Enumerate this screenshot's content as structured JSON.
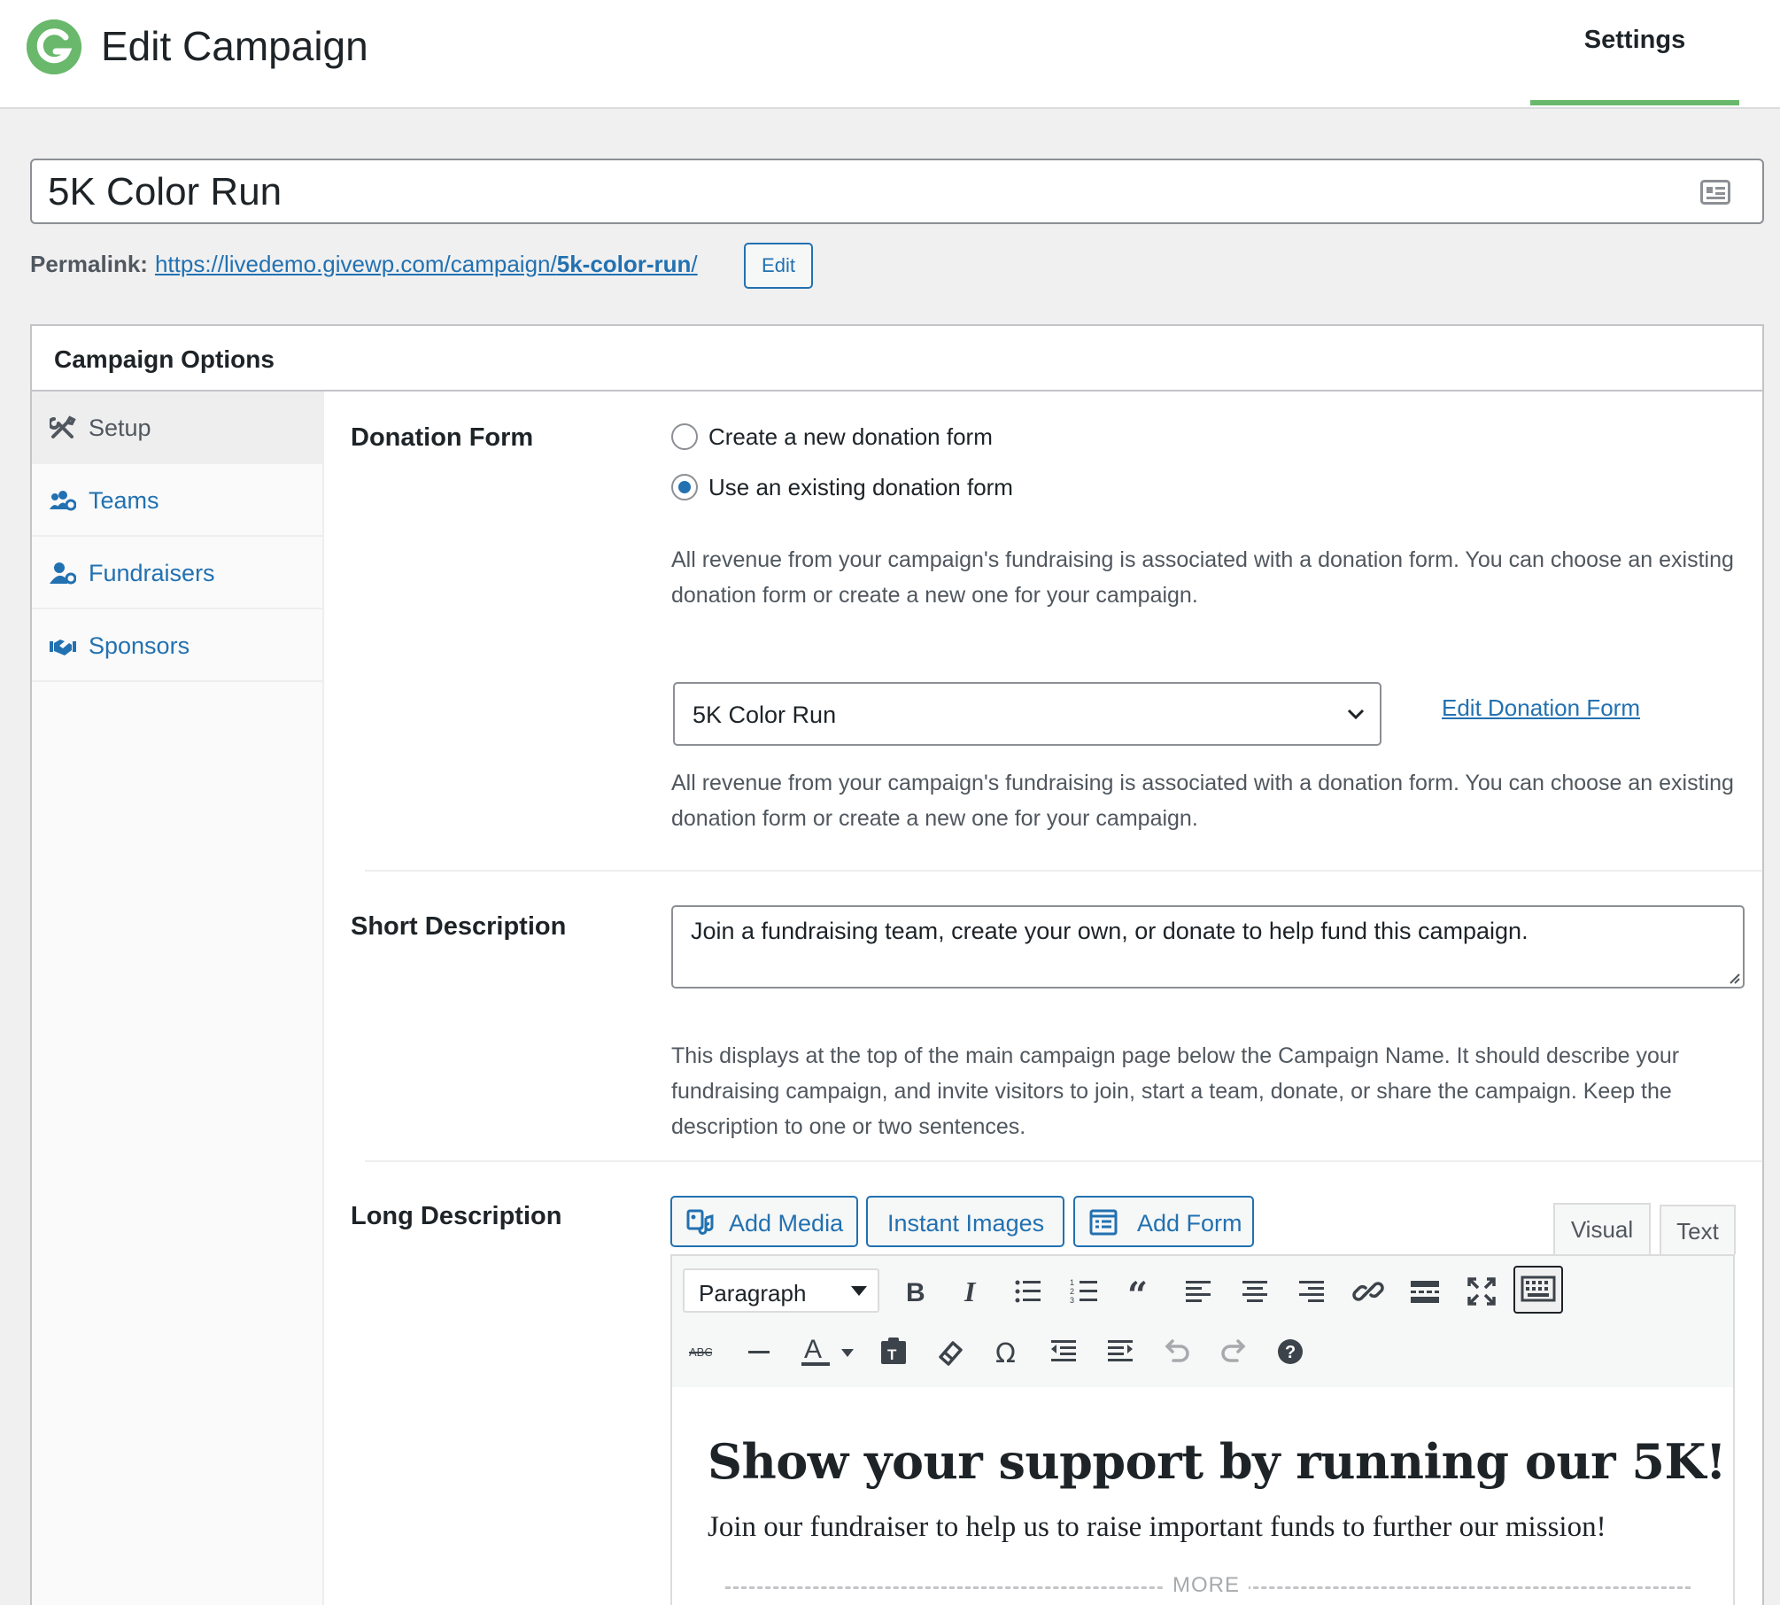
{
  "header": {
    "title": "Edit Campaign",
    "settings_tab": "Settings"
  },
  "campaign": {
    "title_value": "5K Color Run",
    "permalink_label": "Permalink:",
    "permalink_base": "https://livedemo.givewp.com/campaign/",
    "permalink_slug": "5k-color-run",
    "permalink_trailing": "/",
    "permalink_edit": "Edit"
  },
  "panel": {
    "title": "Campaign Options",
    "nav": [
      {
        "label": "Setup",
        "icon": "wrench-screwdriver-icon",
        "active": true
      },
      {
        "label": "Teams",
        "icon": "users-gear-icon",
        "active": false
      },
      {
        "label": "Fundraisers",
        "icon": "user-gear-icon",
        "active": false
      },
      {
        "label": "Sponsors",
        "icon": "handshake-icon",
        "active": false
      }
    ]
  },
  "donation_form": {
    "label": "Donation Form",
    "option_new": "Create a new donation form",
    "option_existing": "Use an existing donation form",
    "selected_option": "existing",
    "help_1": "All revenue from your campaign's fundraising is associated with a donation form. You can choose an existing donation form or create a new one for your campaign.",
    "select_value": "5K Color Run",
    "edit_link": "Edit Donation Form",
    "help_2": "All revenue from your campaign's fundraising is associated with a donation form. You can choose an existing donation form or create a new one for your campaign."
  },
  "short_description": {
    "label": "Short Description",
    "value": "Join a fundraising team, create your own, or donate to help fund this campaign.",
    "help": "This displays at the top of the main campaign page below the Campaign Name. It should describe your fundraising campaign, and invite visitors to join, start a team, donate, or share the campaign. Keep the description to one or two sentences."
  },
  "long_description": {
    "label": "Long Description",
    "buttons": {
      "add_media": "Add Media",
      "instant_images": "Instant Images",
      "add_form": "Add Form"
    },
    "tabs": {
      "visual": "Visual",
      "text": "Text",
      "active": "visual"
    },
    "format_select": "Paragraph",
    "content": {
      "heading": "Show your support by running our 5K!",
      "paragraph": "Join our fundraiser to help us to raise important funds to further our mission!",
      "more": "MORE"
    }
  },
  "colors": {
    "accent": "#2271b1",
    "brand_green": "#69b86b"
  }
}
